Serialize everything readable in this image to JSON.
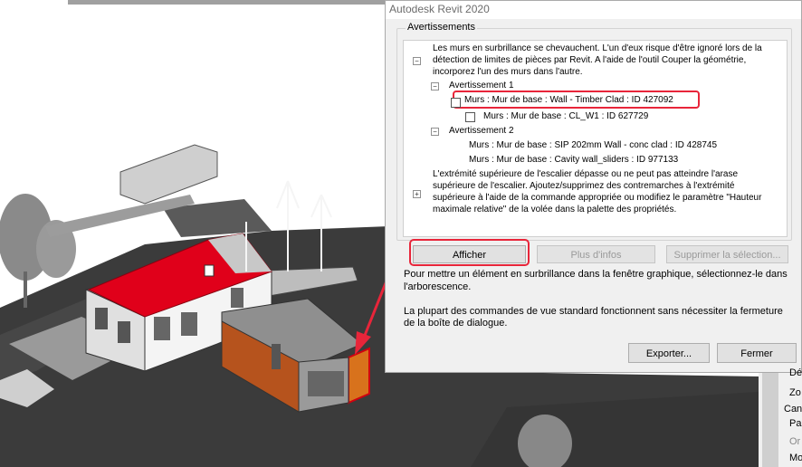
{
  "dialog": {
    "title": "Autodesk Revit 2020",
    "group_title": "Avertissements",
    "warning_text_1": "Les murs en surbrillance se chevauchent. L'un d'eux risque d'être ignoré lors de la",
    "warning_text_2": "détection de limites de pièces par Revit. A l'aide de l'outil Couper la géométrie,",
    "warning_text_3": "incorporez l'un des murs dans l'autre.",
    "tree": {
      "warning1_label": "Avertissement 1",
      "warning1_item1": "Murs : Mur de base : Wall - Timber Clad : ID 427092",
      "warning1_item2": "Murs : Mur de base : CL_W1 : ID 627729",
      "warning2_label": "Avertissement 2",
      "warning2_item1": "Murs : Mur de base : SIP 202mm Wall - conc clad : ID 428745",
      "warning2_item2": "Murs : Mur de base : Cavity wall_sliders : ID 977133"
    },
    "stair_text_1": "L'extrémité supérieure de l'escalier dépasse ou ne peut pas atteindre l'arase",
    "stair_text_2": "supérieure de l'escalier. Ajoutez/supprimez des contremarches à l'extrémité",
    "stair_text_3": "supérieure à l'aide de la commande appropriée ou modifiez le paramètre \"Hauteur",
    "stair_text_4": "maximale relative\" de la volée dans la palette des propriétés.",
    "buttons": {
      "show": "Afficher",
      "more_info": "Plus d'infos",
      "delete_selection": "Supprimer la sélection...",
      "export": "Exporter...",
      "close": "Fermer"
    },
    "info_1": "Pour mettre un élément en surbrillance dans la fenêtre graphique, sélectionnez-le dans",
    "info_2": "l'arborescence.",
    "info_3": "La plupart des commandes de vue standard fonctionnent sans nécessiter la fermeture",
    "info_4": "de la boîte de dialogue."
  },
  "properties_panel": {
    "row1": "Dé",
    "row2": "Zo",
    "row3": "Can",
    "row4": "Pa",
    "row5": "Or",
    "row6": "Mo"
  },
  "colors": {
    "highlight": "#e8253a",
    "roof": "#e0001a",
    "terrain": "#3d3d3d"
  }
}
